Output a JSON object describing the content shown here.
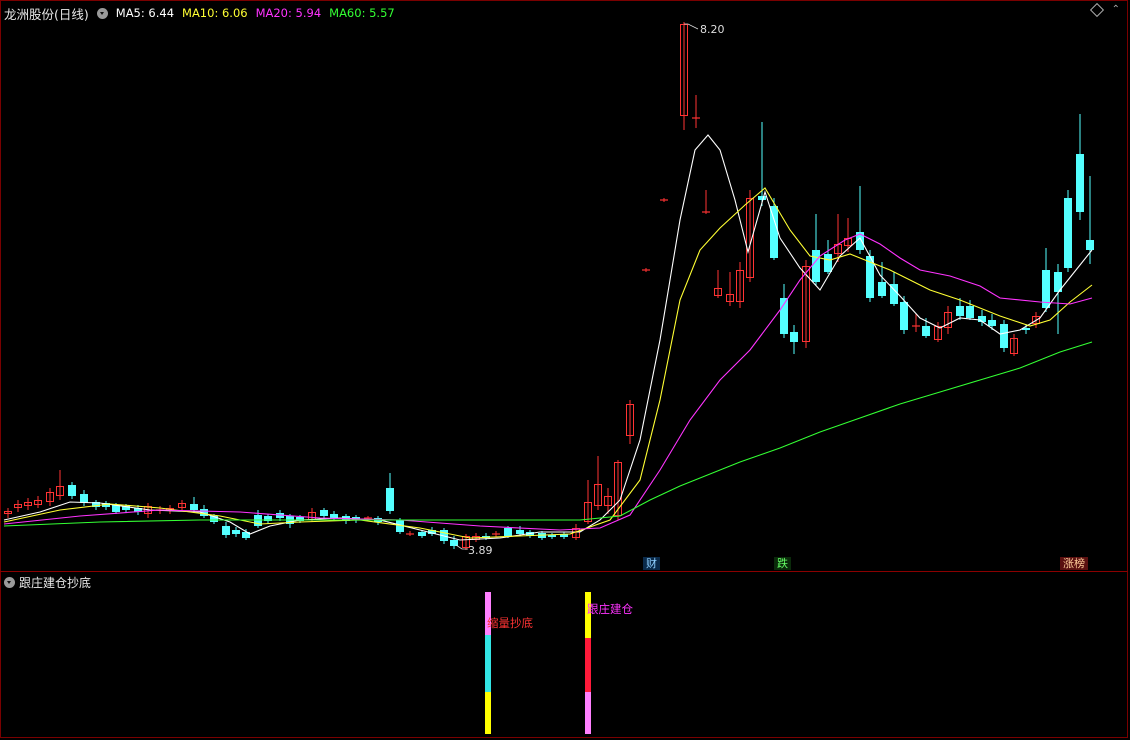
{
  "header": {
    "stock_title": "龙洲股份(日线)",
    "ma": [
      {
        "label": "MA5: 6.44",
        "color": "#ffffff"
      },
      {
        "label": "MA10: 6.06",
        "color": "#ffff33"
      },
      {
        "label": "MA20: 5.94",
        "color": "#ff33ff"
      },
      {
        "label": "MA60: 5.57",
        "color": "#33ff33"
      }
    ]
  },
  "annotations": {
    "high": "8.20",
    "low": "3.89"
  },
  "event_tags": [
    {
      "text": "财",
      "color": "#8fd0ff",
      "bg": "#0a2a4a"
    },
    {
      "text": "跌",
      "color": "#66ff66",
      "bg": "#0a2a0a"
    },
    {
      "text": "涨榜",
      "color": "#ffcc99",
      "bg": "#5a1010"
    }
  ],
  "indicator": {
    "title": "跟庄建仓抄底",
    "signals": [
      {
        "label": "缩量抄底",
        "color": "#ff3333"
      },
      {
        "label": "跟庄建仓",
        "color": "#ff33ff"
      }
    ]
  },
  "colors": {
    "up": "#ff3333",
    "down": "#54ffff",
    "ma5": "#ffffff",
    "ma10": "#ffff33",
    "ma20": "#ff33ff",
    "ma60": "#33ff33"
  }
}
